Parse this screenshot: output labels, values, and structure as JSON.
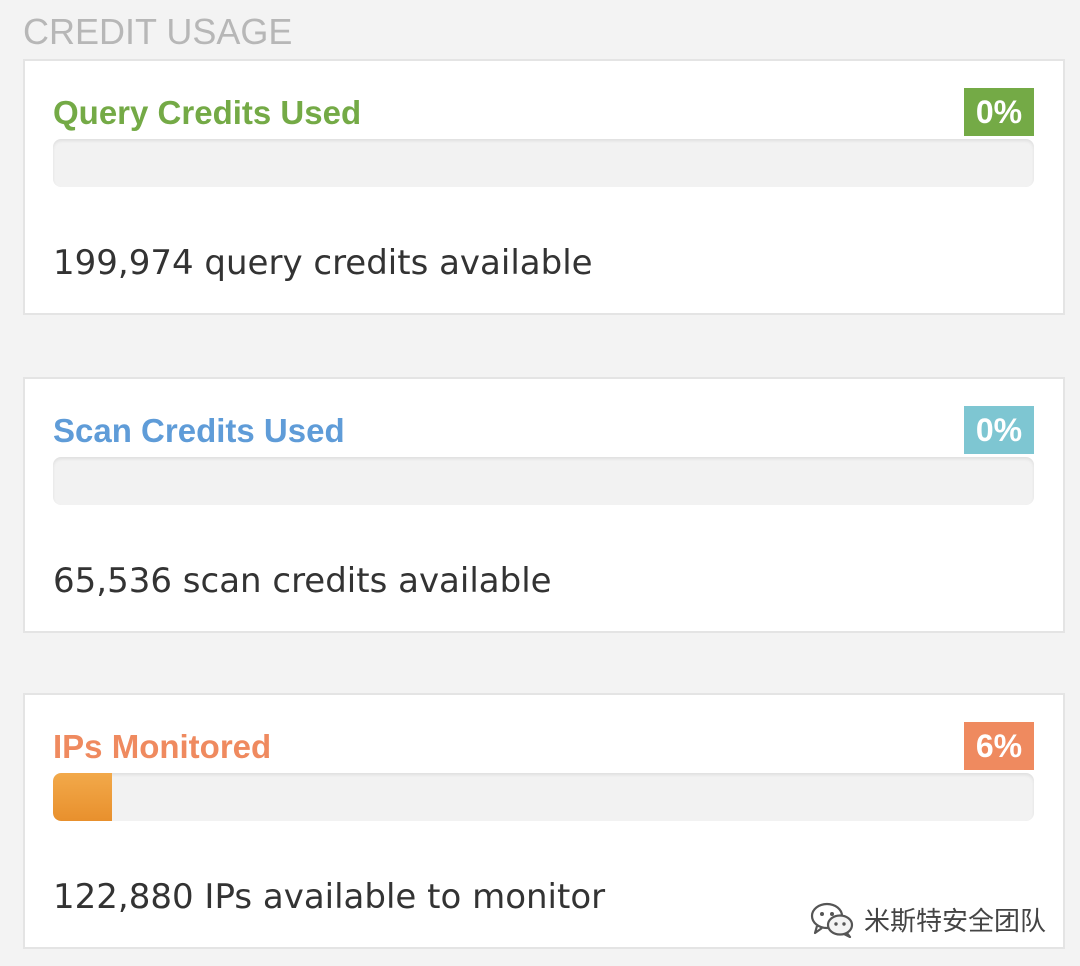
{
  "section_title": "CREDIT USAGE",
  "cards": [
    {
      "id": "query",
      "heading": "Query Credits Used",
      "heading_color": "#74aa46",
      "percent_label": "0%",
      "badge_color": "#74aa46",
      "progress_fraction": 0.0,
      "availability_number": "199,974",
      "availability_text": "query credits available"
    },
    {
      "id": "scan",
      "heading": "Scan Credits Used",
      "heading_color": "#5f9cd8",
      "percent_label": "0%",
      "badge_color": "#7ec6d2",
      "progress_fraction": 0.0,
      "availability_number": "65,536",
      "availability_text": "scan credits available"
    },
    {
      "id": "ips",
      "heading": "IPs Monitored",
      "heading_color": "#ef8a5f",
      "percent_label": "6%",
      "badge_color": "#ef8a5f",
      "progress_fraction": 0.06,
      "availability_number": "122,880",
      "availability_text": "IPs available to monitor"
    }
  ],
  "watermark": {
    "icon": "wechat-icon",
    "text": "米斯特安全团队"
  }
}
